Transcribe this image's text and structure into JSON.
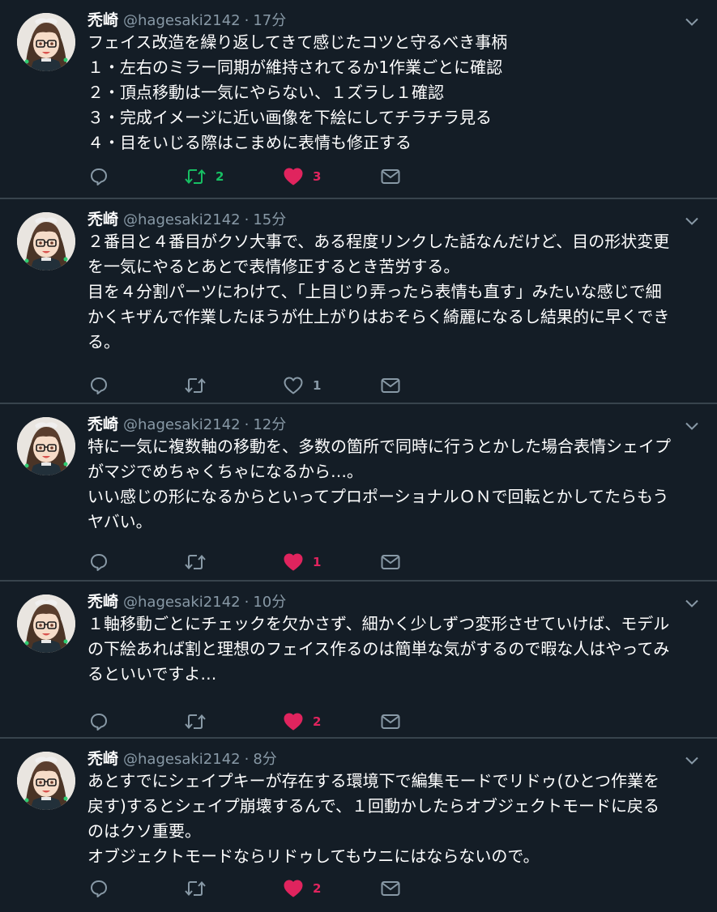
{
  "colors": {
    "background": "#141d26",
    "divider": "#38444d",
    "text": "#ffffff",
    "muted": "#8899a6",
    "retweet_active": "#17bf63",
    "like_active": "#e0245e"
  },
  "icons": {
    "reply": "reply-icon",
    "retweet": "retweet-icon",
    "like": "heart-icon",
    "dm": "envelope-icon",
    "menu": "chevron-down-icon"
  },
  "tweets": [
    {
      "name": "禿崎",
      "handle": "@hagesaki2142",
      "dot": "·",
      "time": "17分",
      "lines": [
        "フェイス改造を繰り返してきて感じたコツと守るべき事柄",
        "１・左右のミラー同期が維持されてるか1作業ごとに確認",
        "２・頂点移動は一気にやらない、１ズラし１確認",
        "３・完成イメージに近い画像を下絵にしてチラチラ見る",
        "４・目をいじる際はこまめに表情も修正する"
      ],
      "retweets": "2",
      "retweeted": true,
      "likes": "3",
      "liked": true
    },
    {
      "name": "禿崎",
      "handle": "@hagesaki2142",
      "dot": "·",
      "time": "15分",
      "lines": [
        "２番目と４番目がクソ大事で、ある程度リンクした話なんだけど、目の形状変更",
        "を一気にやるとあとで表情修正するとき苦労する。",
        "目を４分割パーツにわけて、「上目じり弄ったら表情も直す」みたいな感じで細",
        "かくキザんで作業したほうが仕上がりはおそらく綺麗になるし結果的に早くでき",
        "る。"
      ],
      "retweets": "",
      "retweeted": false,
      "likes": "1",
      "liked": false
    },
    {
      "name": "禿崎",
      "handle": "@hagesaki2142",
      "dot": "·",
      "time": "12分",
      "lines": [
        "特に一気に複数軸の移動を、多数の箇所で同時に行うとかした場合表情シェイプ",
        "がマジでめちゃくちゃになるから…。",
        "いい感じの形になるからといってプロポーショナルＯＮで回転とかしてたらもう",
        "ヤバい。"
      ],
      "retweets": "",
      "retweeted": false,
      "likes": "1",
      "liked": true
    },
    {
      "name": "禿崎",
      "handle": "@hagesaki2142",
      "dot": "·",
      "time": "10分",
      "lines": [
        "１軸移動ごとにチェックを欠かさず、細かく少しずつ変形させていけば、モデル",
        "の下絵あれば割と理想のフェイス作るのは簡単な気がするので暇な人はやってみ",
        "るといいですよ…"
      ],
      "retweets": "",
      "retweeted": false,
      "likes": "2",
      "liked": true
    },
    {
      "name": "禿崎",
      "handle": "@hagesaki2142",
      "dot": "·",
      "time": "8分",
      "lines": [
        "あとすでにシェイプキーが存在する環境下で編集モードでリドゥ(ひとつ作業を",
        "戻す)するとシェイプ崩壊するんで、１回動かしたらオブジェクトモードに戻る",
        "のはクソ重要。",
        "オブジェクトモードならリドゥしてもウニにはならないので。"
      ],
      "retweets": "",
      "retweeted": false,
      "likes": "2",
      "liked": true
    }
  ]
}
